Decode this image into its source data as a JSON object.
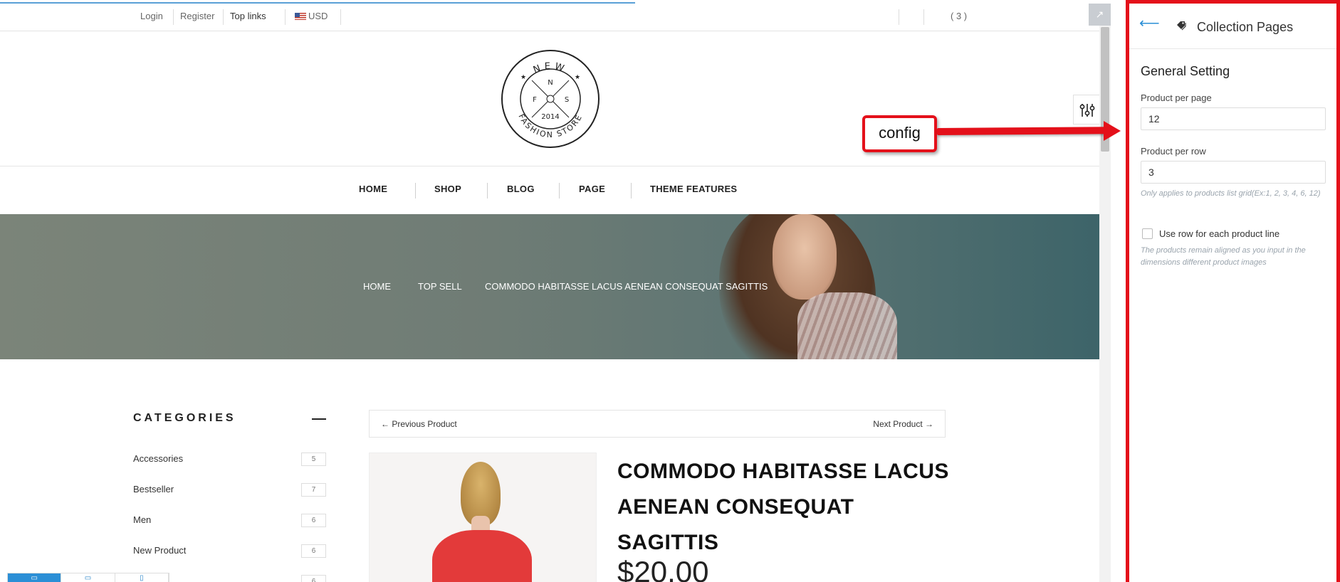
{
  "topbar": {
    "login": "Login",
    "register": "Register",
    "top_links": "Top links",
    "currency": "USD",
    "cart_count": "( 3 )"
  },
  "logo": {
    "top_text": "NEW",
    "bottom_text": "FASHION STORE",
    "north": "N",
    "south": "S",
    "west": "F",
    "year": "2014"
  },
  "nav": [
    "HOME",
    "SHOP",
    "BLOG",
    "PAGE",
    "THEME FEATURES"
  ],
  "breadcrumb": [
    "HOME",
    "TOP SELL",
    "COMMODO HABITASSE LACUS AENEAN CONSEQUAT SAGITTIS"
  ],
  "categories": {
    "title": "CATEGORIES",
    "items": [
      {
        "label": "Accessories",
        "count": "5"
      },
      {
        "label": "Bestseller",
        "count": "7"
      },
      {
        "label": "Men",
        "count": "6"
      },
      {
        "label": "New Product",
        "count": "6"
      },
      {
        "label": "",
        "count": "6"
      }
    ]
  },
  "product_nav": {
    "prev": "← Previous Product",
    "next": "Next Product →"
  },
  "product": {
    "title_line1": "COMMODO HABITASSE LACUS",
    "title_line2": "AENEAN CONSEQUAT SAGITTIS",
    "price": "$20.00"
  },
  "callout": {
    "label": "config",
    "color": "#e4101a"
  },
  "panel": {
    "back_icon": "back-arrow-icon",
    "title": "Collection Pages",
    "section_title": "General Setting",
    "per_page_label": "Product per page",
    "per_page_value": "12",
    "per_row_label": "Product per row",
    "per_row_value": "3",
    "per_row_help": "Only applies to products list grid(Ex:1, 2, 3, 4, 6, 12)",
    "use_row_label": "Use row for each product line",
    "use_row_checked": false,
    "use_row_help": "The products remain aligned as you input in the dimensions different product images"
  },
  "colors": {
    "accent": "#2b8fd6",
    "highlight": "#e4101a"
  }
}
